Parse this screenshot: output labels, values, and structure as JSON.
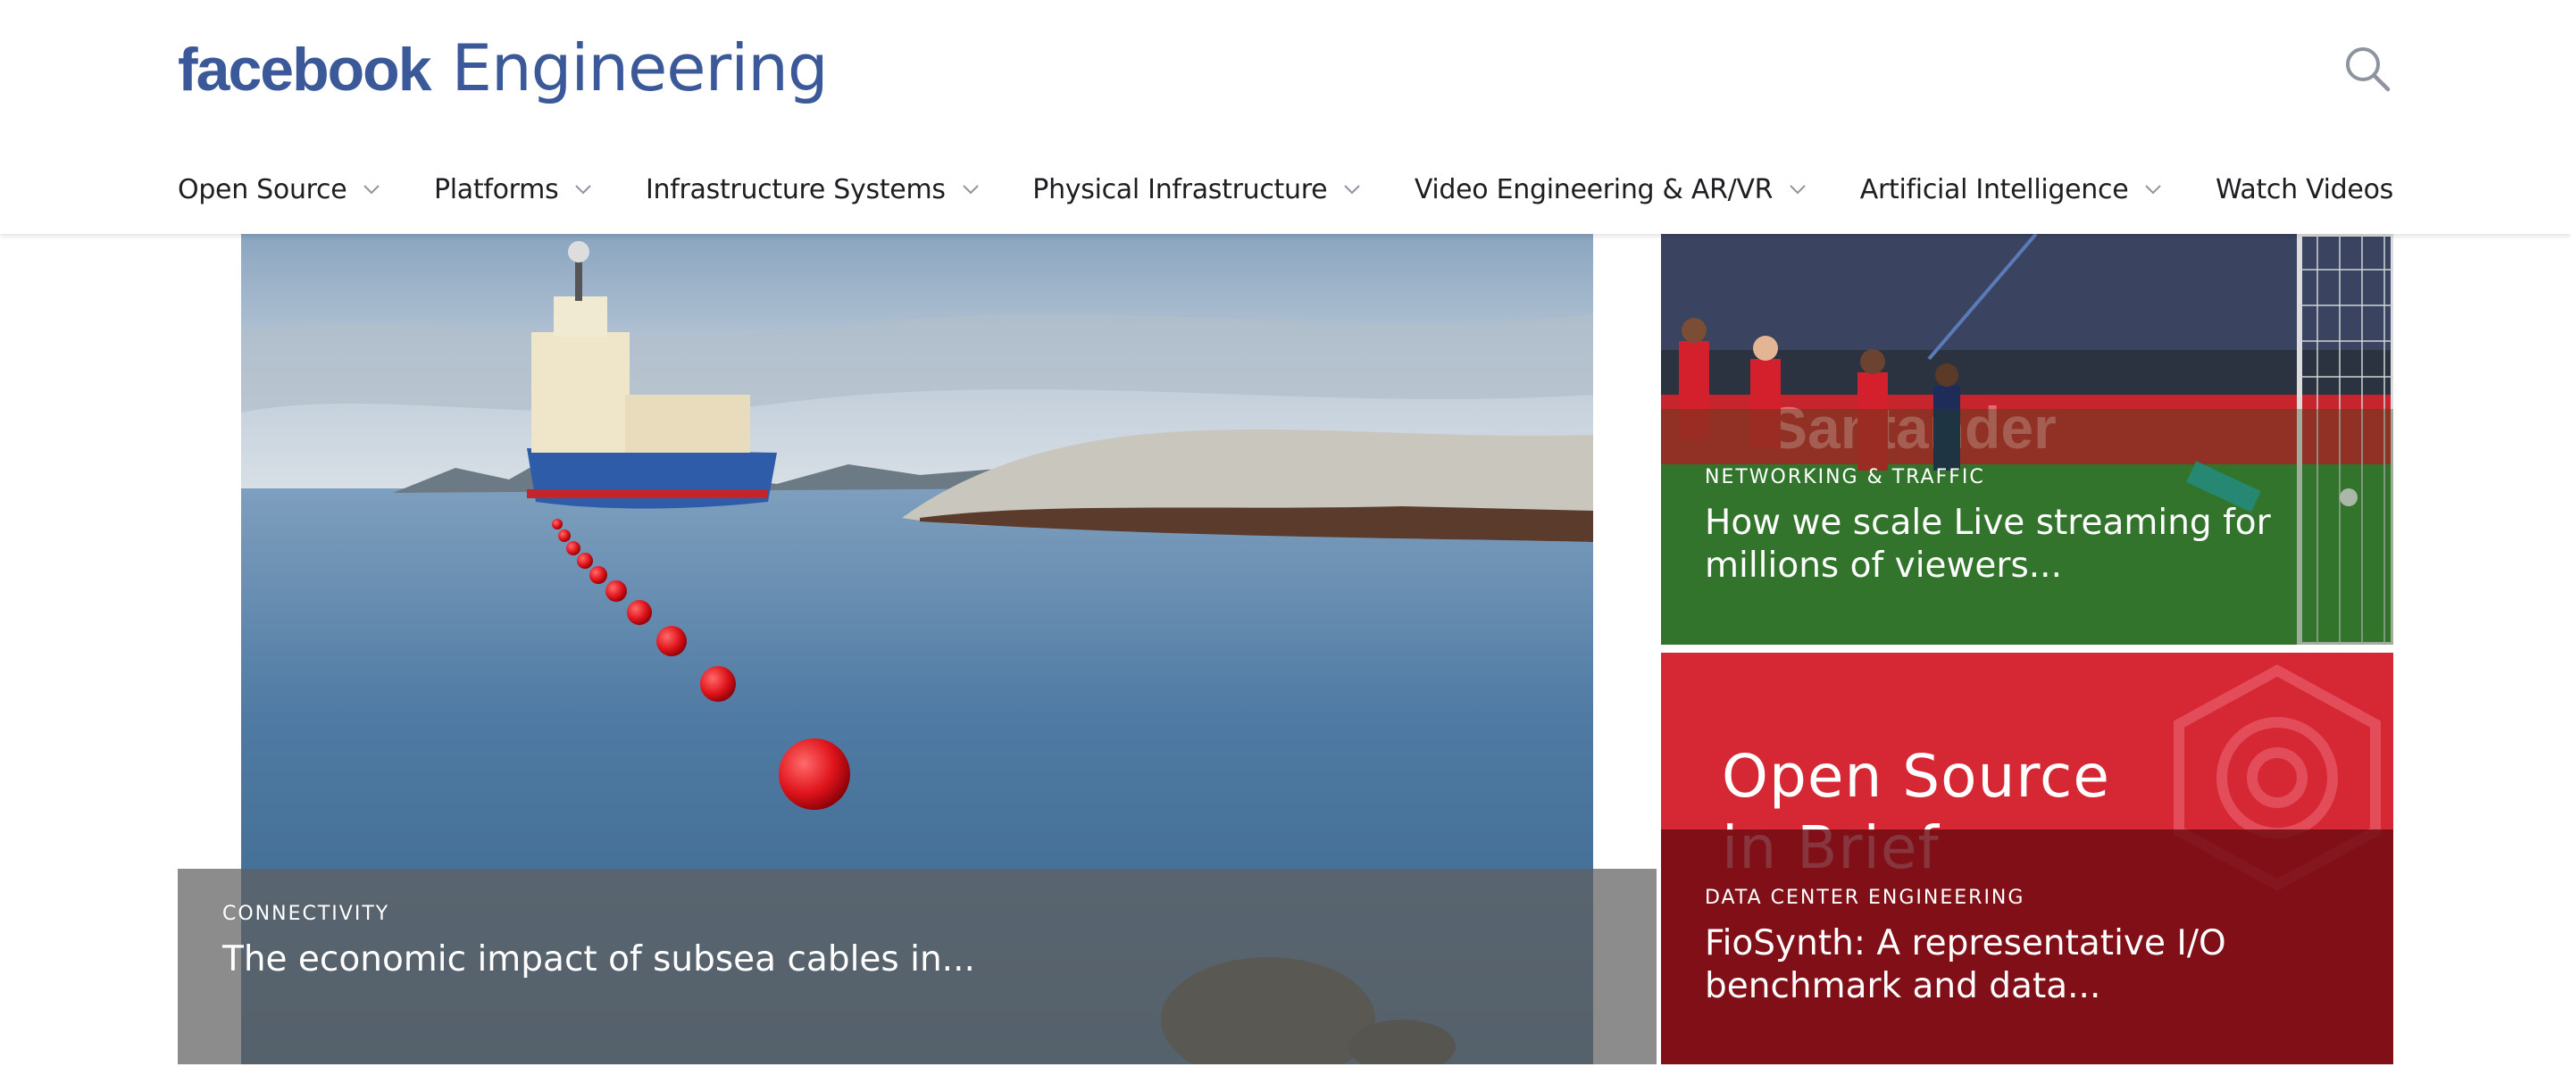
{
  "brand": {
    "name": "facebook",
    "product": "Engineering",
    "color": "#3b5998"
  },
  "header": {
    "search_icon": "search-icon"
  },
  "nav": {
    "items": [
      {
        "label": "Open Source",
        "has_dropdown": true
      },
      {
        "label": "Platforms",
        "has_dropdown": true
      },
      {
        "label": "Infrastructure Systems",
        "has_dropdown": true
      },
      {
        "label": "Physical Infrastructure",
        "has_dropdown": true
      },
      {
        "label": "Video Engineering & AR/VR",
        "has_dropdown": true
      },
      {
        "label": "Artificial Intelligence",
        "has_dropdown": true
      },
      {
        "label": "Watch Videos",
        "has_dropdown": false
      }
    ]
  },
  "featured": {
    "hero": {
      "category": "CONNECTIVITY",
      "title": "The economic impact of subsea cables in..."
    },
    "card1": {
      "category": "NETWORKING & TRAFFIC",
      "title": "How we scale Live streaming for millions of viewers...",
      "image_text": "Santander"
    },
    "card2": {
      "category": "DATA CENTER ENGINEERING",
      "title": "FioSynth: A representative I/O benchmark and data...",
      "image_line1": "Open Source",
      "image_line2": "in Brief",
      "accent": "#d62735"
    }
  }
}
